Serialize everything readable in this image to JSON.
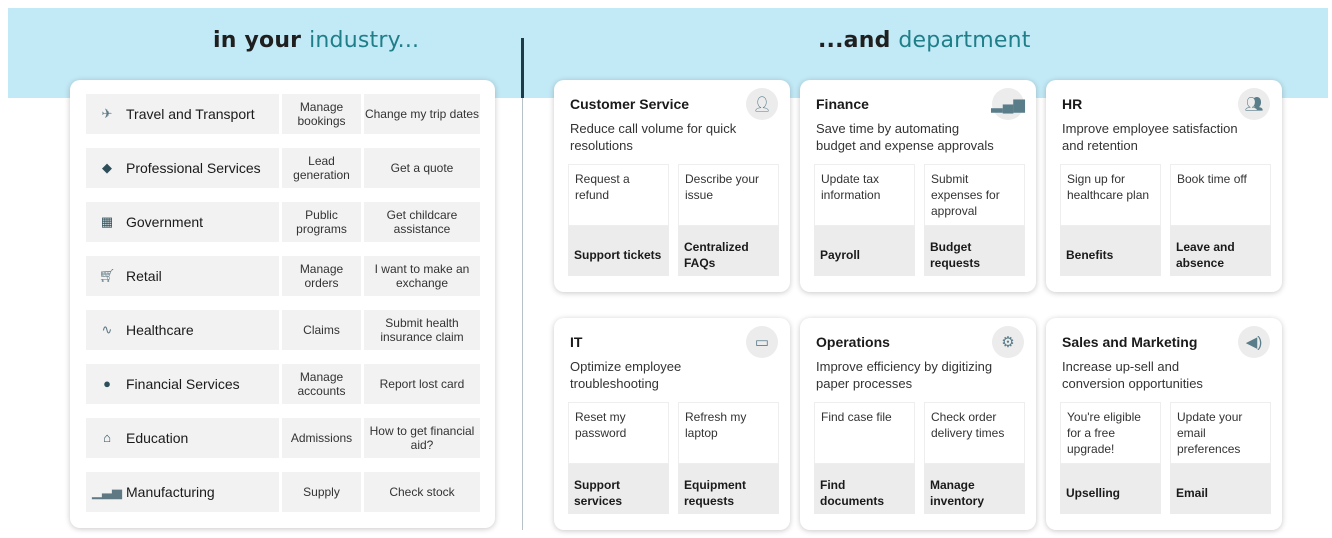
{
  "headings": {
    "left_prefix": "in your",
    "left_accent": "industry...",
    "right_prefix": "...and",
    "right_accent": "department"
  },
  "industries": [
    {
      "name": "Travel and Transport",
      "icon": "airplane-icon",
      "use_case_1": "Manage bookings",
      "use_case_2": "Change my trip dates"
    },
    {
      "name": "Professional Services",
      "icon": "briefcase-icon",
      "use_case_1": "Lead generation",
      "use_case_2": "Get a quote"
    },
    {
      "name": "Government",
      "icon": "government-building-icon",
      "use_case_1": "Public programs",
      "use_case_2": "Get childcare assistance"
    },
    {
      "name": "Retail",
      "icon": "shopping-cart-icon",
      "use_case_1": "Manage orders",
      "use_case_2": "I want to make an exchange"
    },
    {
      "name": "Healthcare",
      "icon": "stethoscope-icon",
      "use_case_1": "Claims",
      "use_case_2": "Submit health insurance claim"
    },
    {
      "name": "Financial Services",
      "icon": "money-icon",
      "use_case_1": "Manage accounts",
      "use_case_2": "Report lost card"
    },
    {
      "name": "Education",
      "icon": "graduation-cap-icon",
      "use_case_1": "Admissions",
      "use_case_2": "How to get financial aid?"
    },
    {
      "name": "Manufacturing",
      "icon": "factory-icon",
      "use_case_1": "Supply",
      "use_case_2": "Check stock"
    }
  ],
  "departments": [
    {
      "title": "Customer Service",
      "icon": "person-icon",
      "description": "Reduce call volume for quick resolutions",
      "tiles": [
        {
          "top": "Request a refund",
          "bottom": "Support tickets"
        },
        {
          "top": "Describe your issue",
          "bottom": "Centralized FAQs"
        }
      ]
    },
    {
      "title": "Finance",
      "icon": "bar-chart-icon",
      "description": "Save time by automating budget and expense approvals",
      "tiles": [
        {
          "top": "Update tax information",
          "bottom": "Payroll"
        },
        {
          "top": "Submit expenses for approval",
          "bottom": "Budget requests"
        }
      ]
    },
    {
      "title": "HR",
      "icon": "people-icon",
      "description": "Improve employee satisfaction and retention",
      "tiles": [
        {
          "top": "Sign up for healthcare plan",
          "bottom": "Benefits"
        },
        {
          "top": "Book time off",
          "bottom": "Leave and absence"
        }
      ]
    },
    {
      "title": "IT",
      "icon": "laptop-icon",
      "description": "Optimize employee troubleshooting",
      "tiles": [
        {
          "top": "Reset my password",
          "bottom": "Support services"
        },
        {
          "top": "Refresh my laptop",
          "bottom": "Equipment requests"
        }
      ]
    },
    {
      "title": "Operations",
      "icon": "gears-icon",
      "description": "Improve efficiency by digitizing paper processes",
      "tiles": [
        {
          "top": "Find case file",
          "bottom": "Find documents"
        },
        {
          "top": "Check order delivery times",
          "bottom": "Manage inventory"
        }
      ]
    },
    {
      "title": "Sales and Marketing",
      "icon": "megaphone-icon",
      "description": "Increase up-sell and conversion opportunities",
      "tiles": [
        {
          "top": "You're eligible for a free upgrade!",
          "bottom": "Upselling"
        },
        {
          "top": "Update your email preferences",
          "bottom": "Email"
        }
      ]
    }
  ]
}
